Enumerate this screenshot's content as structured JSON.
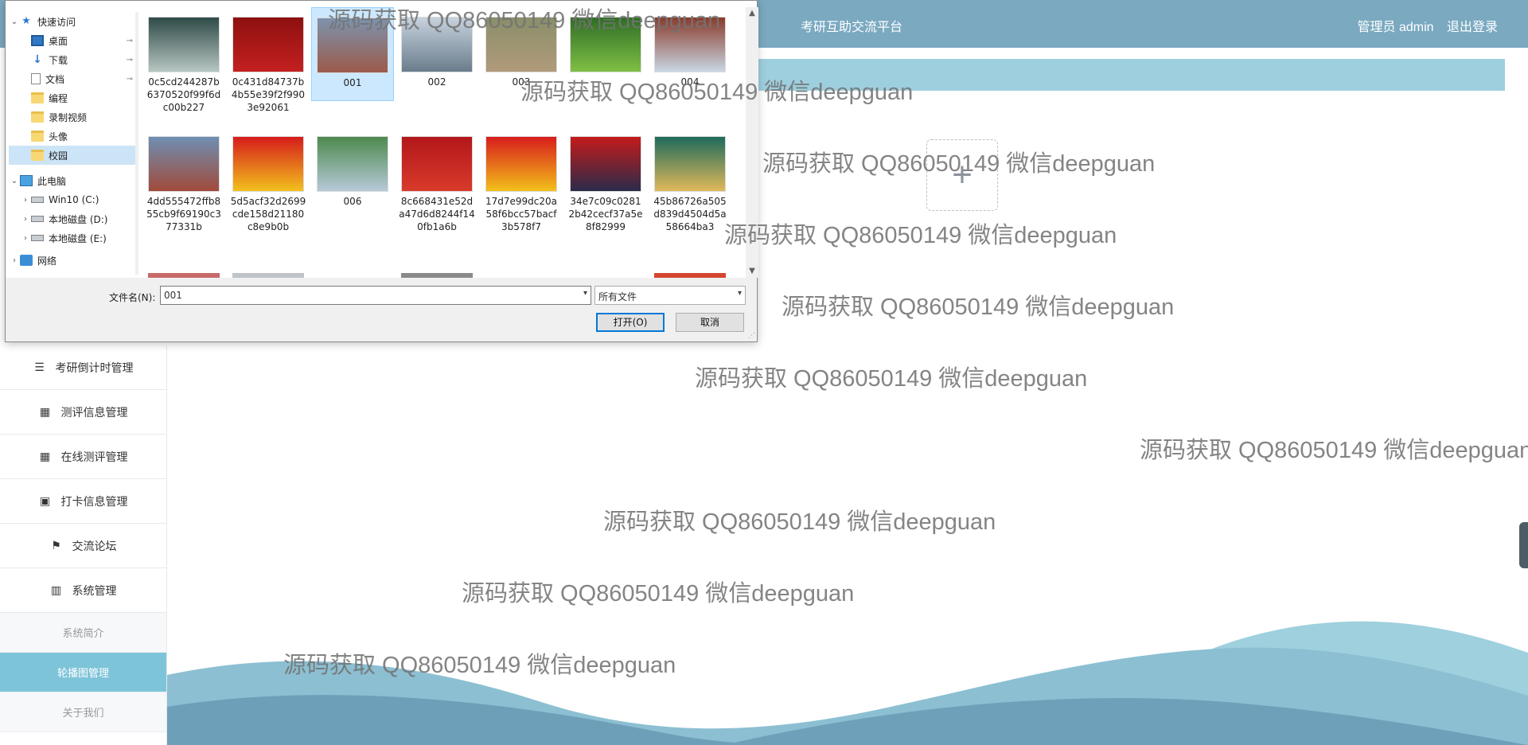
{
  "header": {
    "app_title": "考研互助交流平台",
    "user_text": "管理员 admin",
    "logout_label": "退出登录"
  },
  "sidebar": {
    "items": [
      {
        "label": "考研倒计时管理",
        "icon": "list-icon"
      },
      {
        "label": "测评信息管理",
        "icon": "grid-icon"
      },
      {
        "label": "在线测评管理",
        "icon": "grid-icon"
      },
      {
        "label": "打卡信息管理",
        "icon": "clipboard-check-icon"
      },
      {
        "label": "交流论坛",
        "icon": "flag-icon"
      },
      {
        "label": "系统管理",
        "icon": "books-icon"
      }
    ],
    "sub_items": [
      {
        "label": "系统简介",
        "active": false
      },
      {
        "label": "轮播图管理",
        "active": true
      },
      {
        "label": "关于我们",
        "active": false
      }
    ]
  },
  "upload": {
    "plus": "+"
  },
  "watermark_text": "源码获取 QQ86050149 微信deepguan",
  "dialog": {
    "nav": [
      {
        "label": "快速访问",
        "icon": "star-icon",
        "level": 0,
        "expanded": true
      },
      {
        "label": "桌面",
        "icon": "desktop-icon",
        "level": 1,
        "pinned": true
      },
      {
        "label": "下载",
        "icon": "download-icon",
        "level": 1,
        "pinned": true
      },
      {
        "label": "文档",
        "icon": "document-icon",
        "level": 1,
        "pinned": true
      },
      {
        "label": "编程",
        "icon": "folder-icon",
        "level": 1
      },
      {
        "label": "录制视频",
        "icon": "folder-icon",
        "level": 1
      },
      {
        "label": "头像",
        "icon": "folder-icon",
        "level": 1
      },
      {
        "label": "校园",
        "icon": "folder-icon",
        "level": 1,
        "selected": true
      },
      {
        "label": "此电脑",
        "icon": "computer-icon",
        "level": 0,
        "expanded": true
      },
      {
        "label": "Win10 (C:)",
        "icon": "drive-icon",
        "level": 1,
        "collapsed": true
      },
      {
        "label": "本地磁盘 (D:)",
        "icon": "drive-icon",
        "level": 1,
        "collapsed": true
      },
      {
        "label": "本地磁盘 (E:)",
        "icon": "drive-icon",
        "level": 1,
        "collapsed": true
      },
      {
        "label": "网络",
        "icon": "network-icon",
        "level": 0,
        "collapsed": true
      }
    ],
    "files": [
      {
        "name": "0c5cd244287b6370520f99f6dc00b227",
        "colors": [
          "#2e4a47",
          "#b7c6c2"
        ]
      },
      {
        "name": "0c431d84737b4b55e39f2f9903e92061",
        "colors": [
          "#8e1010",
          "#c42020"
        ]
      },
      {
        "name": "001",
        "colors": [
          "#7c93ad",
          "#9b5a4a"
        ],
        "selected": true
      },
      {
        "name": "002",
        "colors": [
          "#c7d3de",
          "#6a7c8c"
        ]
      },
      {
        "name": "003",
        "colors": [
          "#8a8f6a",
          "#b09a7a"
        ]
      },
      {
        "name": "",
        "colors": [
          "#2f6d25",
          "#7fbf45"
        ]
      },
      {
        "name": "004",
        "colors": [
          "#8a3a2a",
          "#c8d6e4"
        ]
      },
      {
        "name": "4dd555472ffb855cb9f69190c377331b",
        "colors": [
          "#6e8fb3",
          "#a14a3a"
        ]
      },
      {
        "name": "5d5acf32d2699cde158d21180c8e9b0b",
        "colors": [
          "#d61c1c",
          "#f2c11d"
        ]
      },
      {
        "name": "006",
        "colors": [
          "#4d8a4d",
          "#b7c9d9"
        ]
      },
      {
        "name": "8c668431e52da47d6d8244f140fb1a6b",
        "colors": [
          "#b3171a",
          "#d83a2a"
        ]
      },
      {
        "name": "17d7e99dc20a58f6bcc57bacf3b578f7",
        "colors": [
          "#d81c1c",
          "#f2c01a"
        ]
      },
      {
        "name": "34e7c09c02812b42cecf37a5e8f82999",
        "colors": [
          "#c41b1b",
          "#2b2b4a"
        ]
      },
      {
        "name": "45b86726a505d839d4504d5a58664ba3",
        "colors": [
          "#1e6a5c",
          "#e0b95a"
        ]
      }
    ],
    "filename_label": "文件名(N):",
    "filename_value": "001",
    "filetype_value": "所有文件",
    "open_label": "打开(O)",
    "cancel_label": "取消"
  }
}
